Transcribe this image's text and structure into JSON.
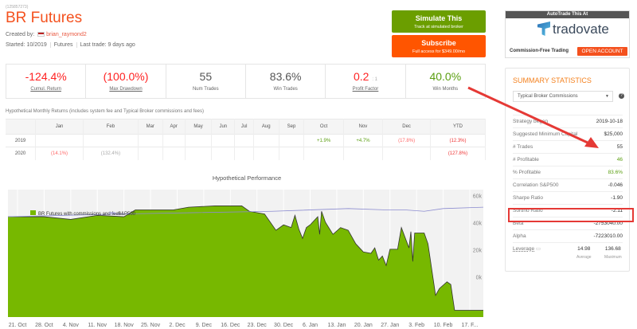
{
  "header": {
    "strategy_id": "(125857273)",
    "title": "BR Futures",
    "created_by_label": "Created by:",
    "author": "brian_raymond2",
    "started": "Started: 10/2019",
    "category": "Futures",
    "last_trade": "Last trade: 9 days ago"
  },
  "buttons": {
    "simulate_title": "Simulate This",
    "simulate_sub": "Track at simulated broker",
    "subscribe_title": "Subscribe",
    "subscribe_sub": "Full access for $349.00/mo"
  },
  "stats": [
    {
      "value": "-124.4%",
      "label": "Cumul. Return"
    },
    {
      "value": "(100.0%)",
      "label": "Max Drawdown"
    },
    {
      "value": "55",
      "label": "Num Trades"
    },
    {
      "value": "83.6%",
      "label": "Win Trades"
    },
    {
      "value": "0.2",
      "suffix": ": 1",
      "label": "Profit Factor"
    },
    {
      "value": "40.0%",
      "label": "Win Months"
    }
  ],
  "monthly": {
    "title": "Hypothetical Monthly Returns (includes system fee and Typical Broker commissions and fees)",
    "headers": [
      "",
      "Jan",
      "Feb",
      "Mar",
      "Apr",
      "May",
      "Jun",
      "Jul",
      "Aug",
      "Sep",
      "Oct",
      "Nov",
      "Dec",
      "YTD"
    ],
    "rows": [
      [
        "2019",
        "",
        "",
        "",
        "",
        "",
        "",
        "",
        "",
        "",
        "+1.9%",
        "+4.7%",
        "(17.8%)",
        "(12.3%)"
      ],
      [
        "2020",
        "(14.1%)",
        "(132.4%)",
        "",
        "",
        "",
        "",
        "",
        "",
        "",
        "",
        "",
        "",
        "(127.8%)"
      ]
    ]
  },
  "ad": {
    "header": "AutoTrade This At",
    "brand": "tradovate",
    "tagline": "Commission-Free Trading",
    "cta": "OPEN ACCOUNT"
  },
  "summary": {
    "title": "SUMMARY STATISTICS",
    "select": "Typical Broker Commissions",
    "help": "?",
    "rows": [
      [
        "Strategy began",
        "2019-10-18"
      ],
      [
        "Suggested Minimum Capital",
        "$25,000"
      ],
      [
        "# Trades",
        "55"
      ],
      [
        "# Profitable",
        "46"
      ],
      [
        "% Profitable",
        "83.6%"
      ],
      [
        "Correlation S&P500",
        "-0.046"
      ],
      [
        "Sharpe Ratio",
        "-1.90"
      ],
      [
        "Sortino Ratio",
        "-2.11"
      ],
      [
        "Beta",
        "-2753040.00"
      ],
      [
        "Alpha",
        "-7223010.00"
      ]
    ],
    "leverage": {
      "label": "Leverage",
      "average": "14.98",
      "average_label": "Average",
      "maximum": "136.68",
      "maximum_label": "Maximum"
    }
  },
  "chart_data": {
    "type": "area",
    "title": "Hypothetical Performance",
    "legend": [
      "BR Futures with commissions and fees",
      "S&P500"
    ],
    "legend_placement": "top-left",
    "x_ticks": [
      "21. Oct",
      "28. Oct",
      "4. Nov",
      "11. Nov",
      "18. Nov",
      "25. Nov",
      "2. Dec",
      "9. Dec",
      "16. Dec",
      "23. Dec",
      "30. Dec",
      "6. Jan",
      "13. Jan",
      "20. Jan",
      "27. Jan",
      "3. Feb",
      "10. Feb",
      "17. F..."
    ],
    "y_ticks": [
      "0k",
      "20k",
      "40k",
      "60k"
    ],
    "ylim": [
      -26,
      68
    ],
    "x_unit": "days since 2019-10-18",
    "series": [
      {
        "name": "BR Futures with commissions and fees",
        "color": "#77b800",
        "points": [
          [
            0,
            48
          ],
          [
            10,
            48
          ],
          [
            17,
            46
          ],
          [
            24,
            49
          ],
          [
            31,
            48
          ],
          [
            34,
            53
          ],
          [
            44,
            53
          ],
          [
            48,
            55
          ],
          [
            55,
            56
          ],
          [
            62,
            56
          ],
          [
            64,
            52
          ],
          [
            68,
            50
          ],
          [
            71,
            38
          ],
          [
            73,
            42
          ],
          [
            75,
            40
          ],
          [
            76,
            49
          ],
          [
            77,
            39
          ],
          [
            78,
            32
          ],
          [
            79,
            40
          ],
          [
            80,
            42
          ],
          [
            82,
            48
          ],
          [
            82.5,
            35
          ],
          [
            83,
            52
          ],
          [
            84,
            44
          ],
          [
            86,
            35
          ],
          [
            88,
            40
          ],
          [
            90,
            38
          ],
          [
            92,
            28
          ],
          [
            94,
            22
          ],
          [
            96,
            21
          ],
          [
            97,
            25
          ],
          [
            98,
            16
          ],
          [
            99,
            19
          ],
          [
            100,
            12
          ],
          [
            101,
            24
          ],
          [
            103,
            24
          ],
          [
            104,
            40
          ],
          [
            106,
            25
          ],
          [
            106.5,
            37
          ],
          [
            107,
            15
          ],
          [
            107.5,
            36
          ],
          [
            110,
            36
          ],
          [
            111,
            28
          ],
          [
            113,
            -10
          ],
          [
            114,
            -5
          ],
          [
            116,
            0
          ],
          [
            117,
            -2
          ],
          [
            118,
            -21
          ],
          [
            124,
            -21
          ]
        ]
      },
      {
        "name": "S&P500",
        "color": "#8c8cd0",
        "points": [
          [
            0,
            48
          ],
          [
            30,
            50
          ],
          [
            50,
            51
          ],
          [
            70,
            52
          ],
          [
            90,
            54
          ],
          [
            100,
            53
          ],
          [
            105,
            53
          ],
          [
            110,
            52
          ],
          [
            115,
            54
          ],
          [
            124,
            55
          ]
        ]
      }
    ]
  }
}
